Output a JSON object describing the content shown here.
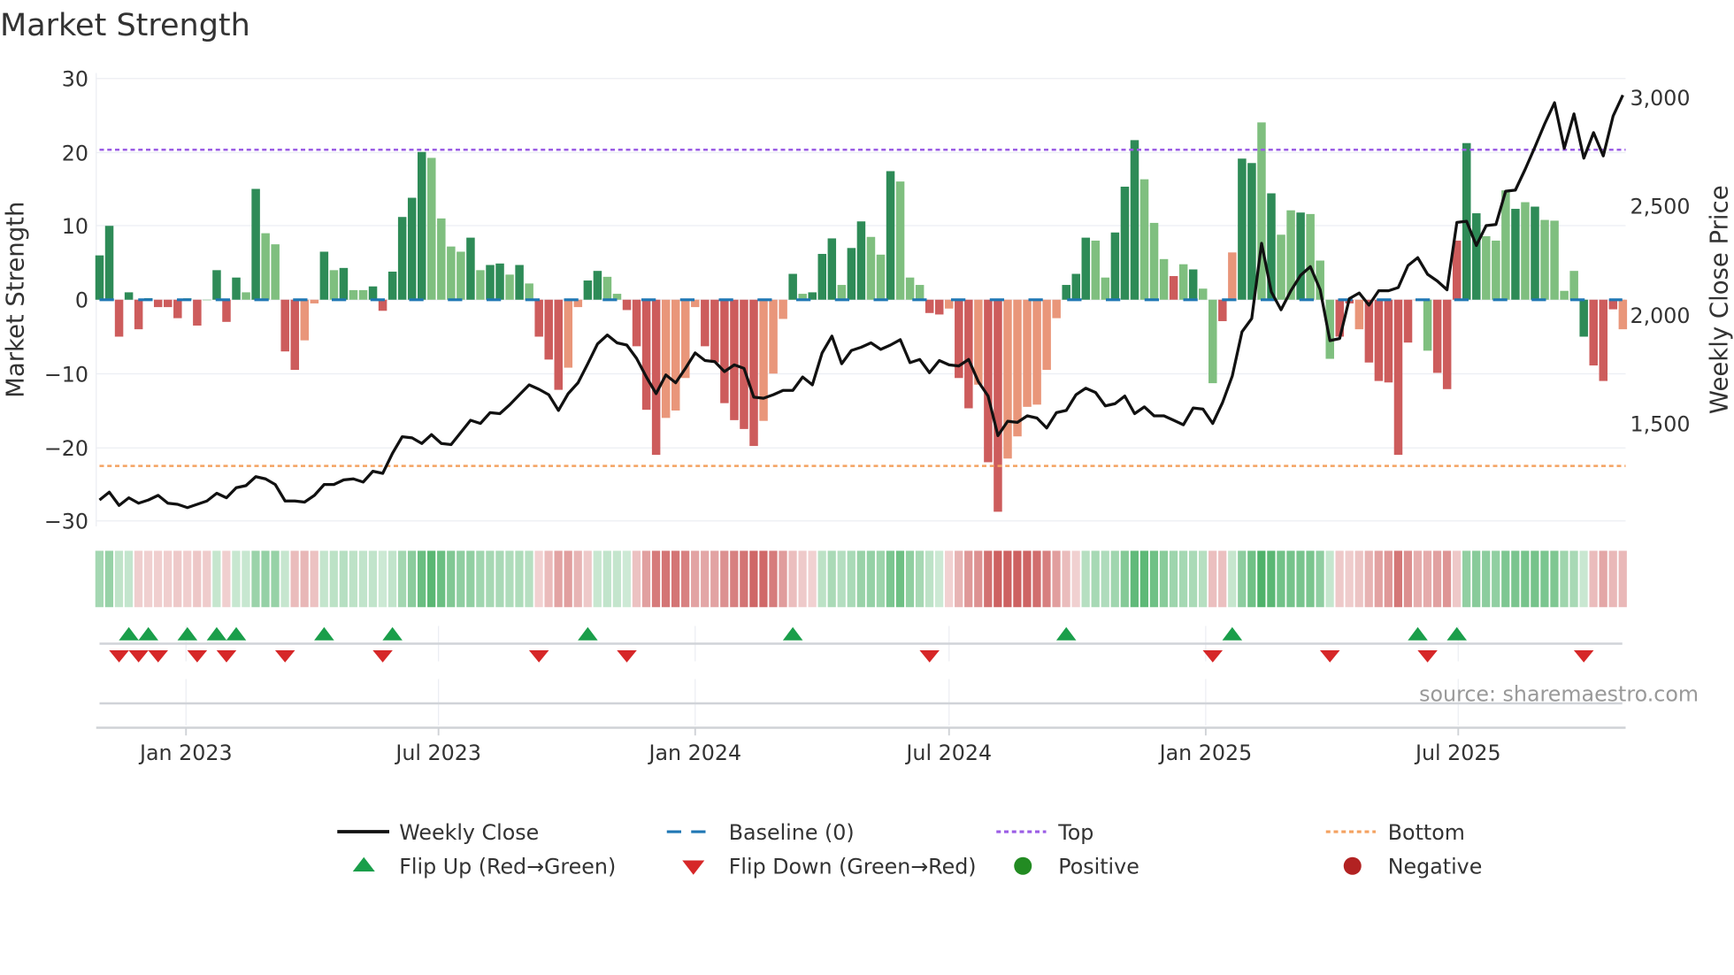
{
  "chart_data": {
    "type": "bar",
    "title": "Market Strength",
    "ylabel": "Market Strength",
    "y2label": "Weekly Close Price",
    "ylim": [
      -30,
      30
    ],
    "y2lim": [
      1070,
      3100
    ],
    "yticks": [
      "30",
      "20",
      "10",
      "0",
      "−10",
      "−20",
      "−30"
    ],
    "y2ticks": [
      "3,000",
      "2,500",
      "2,000",
      "1,500"
    ],
    "y2tick_values": [
      3000,
      2500,
      2000,
      1500
    ],
    "xticks": [
      {
        "label": "Jan 2023",
        "date": "2023-01-01"
      },
      {
        "label": "Jul 2023",
        "date": "2023-07-01"
      },
      {
        "label": "Jan 2024",
        "date": "2024-01-01"
      },
      {
        "label": "Jul 2024",
        "date": "2024-07-01"
      },
      {
        "label": "Jan 2025",
        "date": "2025-01-01"
      },
      {
        "label": "Jul 2025",
        "date": "2025-07-01"
      }
    ],
    "start_date": "2022-10-31",
    "frequency": "weekly",
    "top_level": 20.3,
    "bottom_level": -22.5,
    "baseline": 0,
    "strength": [
      6,
      10,
      -5,
      1,
      -4,
      0.2,
      -1,
      -1,
      -2.5,
      0.2,
      -3.5,
      0,
      4,
      -3,
      3,
      1,
      15,
      9,
      7.5,
      -7,
      -9.5,
      -5.5,
      -0.5,
      6.5,
      4,
      4.3,
      1.3,
      1.3,
      1.8,
      -1.5,
      3.8,
      11.2,
      13.8,
      20,
      19.2,
      11,
      7.2,
      6.5,
      8.4,
      4,
      4.7,
      4.9,
      3.4,
      4.7,
      2.2,
      -5,
      -8.1,
      -12.2,
      -9.2,
      -1,
      2.6,
      3.9,
      3.1,
      0.8,
      -1.4,
      -6.3,
      -14.9,
      -21,
      -16,
      -15,
      -10.6,
      -1,
      -6.3,
      -8.5,
      -14,
      -16.3,
      -17.5,
      -19.8,
      -16.4,
      -10,
      -2.6,
      3.5,
      0.8,
      1,
      6.2,
      8.3,
      2,
      7,
      10.6,
      8.5,
      6.1,
      17.4,
      16,
      3,
      2,
      -1.8,
      -2,
      -1.2,
      -10.6,
      -14.7,
      -11.5,
      -22,
      -28.7,
      -21.5,
      -18.5,
      -14.5,
      -14.2,
      -9.5,
      -2.5,
      2,
      3.5,
      8.4,
      8,
      3,
      9.1,
      15.3,
      21.6,
      16.3,
      10.4,
      5.5,
      3.2,
      4.8,
      4.1,
      1.5,
      -11.3,
      -2.9,
      6.4,
      19.1,
      18.5,
      24,
      14.4,
      8.8,
      12.1,
      11.8,
      11.6,
      5.3,
      -8,
      -5,
      -0.5,
      -4,
      -8.5,
      -11,
      -11.2,
      -21,
      -5.8,
      0,
      -6.9,
      -9.9,
      -12.1,
      8,
      21.2,
      11.7,
      8.6,
      8,
      14.8,
      12.3,
      13.2,
      12.6,
      10.8,
      10.7,
      1.2,
      3.9,
      -5,
      -8.9,
      -11,
      -1.3,
      -4
    ],
    "strength_shade": "GGRGRGRRRgRgGRGgGggRRrrGgGggGRGGGGggggGgGGgGgRRRrrGGggRRRRrrrrRRRRRRrrrGgGGGgGGggGgggRRrRRrRRrrrrrrGGGggGGGgggRgGggRrGGgGggGgggRRrRRRRRrgRRRGGgggGgGggggGRRRrR",
    "weekly_close": [
      1152,
      1188,
      1127,
      1162,
      1137,
      1152,
      1173,
      1137,
      1132,
      1117,
      1132,
      1147,
      1183,
      1162,
      1208,
      1218,
      1259,
      1249,
      1223,
      1147,
      1147,
      1142,
      1173,
      1223,
      1223,
      1244,
      1249,
      1234,
      1284,
      1274,
      1366,
      1442,
      1437,
      1411,
      1452,
      1411,
      1406,
      1462,
      1518,
      1503,
      1553,
      1548,
      1589,
      1635,
      1680,
      1660,
      1635,
      1563,
      1640,
      1690,
      1777,
      1868,
      1909,
      1873,
      1863,
      1802,
      1716,
      1640,
      1726,
      1690,
      1756,
      1827,
      1792,
      1787,
      1741,
      1772,
      1756,
      1624,
      1619,
      1635,
      1655,
      1655,
      1716,
      1680,
      1827,
      1904,
      1777,
      1838,
      1853,
      1873,
      1843,
      1863,
      1888,
      1782,
      1797,
      1736,
      1792,
      1772,
      1767,
      1797,
      1695,
      1629,
      1447,
      1513,
      1508,
      1538,
      1528,
      1482,
      1553,
      1563,
      1635,
      1665,
      1645,
      1584,
      1594,
      1629,
      1548,
      1579,
      1538,
      1538,
      1518,
      1497,
      1574,
      1569,
      1503,
      1599,
      1721,
      1924,
      1985,
      2330,
      2107,
      2025,
      2112,
      2183,
      2223,
      2117,
      1883,
      1893,
      2076,
      2102,
      2046,
      2112,
      2112,
      2127,
      2228,
      2264,
      2188,
      2157,
      2117,
      2426,
      2431,
      2320,
      2411,
      2416,
      2569,
      2574,
      2670,
      2772,
      2878,
      2975,
      2766,
      2924,
      2721,
      2838,
      2731,
      2914,
      3010
    ],
    "flip_up_weeks": [
      3,
      5,
      9,
      12,
      14,
      23,
      30,
      50,
      71,
      99,
      116,
      135,
      139
    ],
    "flip_down_weeks": [
      2,
      4,
      6,
      10,
      13,
      19,
      29,
      45,
      54,
      85,
      114,
      126,
      136,
      152
    ],
    "legend": [
      {
        "label": "Weekly Close",
        "kind": "line"
      },
      {
        "label": "Baseline (0)",
        "kind": "dash"
      },
      {
        "label": "Top",
        "kind": "dot"
      },
      {
        "label": "Bottom",
        "kind": "dot"
      },
      {
        "label": "Flip Up (Red→Green)",
        "kind": "tri-up"
      },
      {
        "label": "Flip Down (Green→Red)",
        "kind": "tri-down"
      },
      {
        "label": "Positive",
        "kind": "circle"
      },
      {
        "label": "Negative",
        "kind": "circle"
      }
    ],
    "legend_placement": "bottom",
    "colors": {
      "strong_pos": "#2e8b57",
      "weak_pos": "#7fbf7f",
      "strong_neg": "#cd5c5c",
      "weak_neg": "#e9967a",
      "price": "#111111",
      "baseline": "#1f77b4",
      "top": "#9b5de5",
      "bottom": "#f4a261",
      "flip_up": "#1a9e4a",
      "flip_down": "#d62728",
      "positive": "#228b22",
      "negative": "#b22222"
    }
  },
  "source": "source: sharemaestro.com"
}
